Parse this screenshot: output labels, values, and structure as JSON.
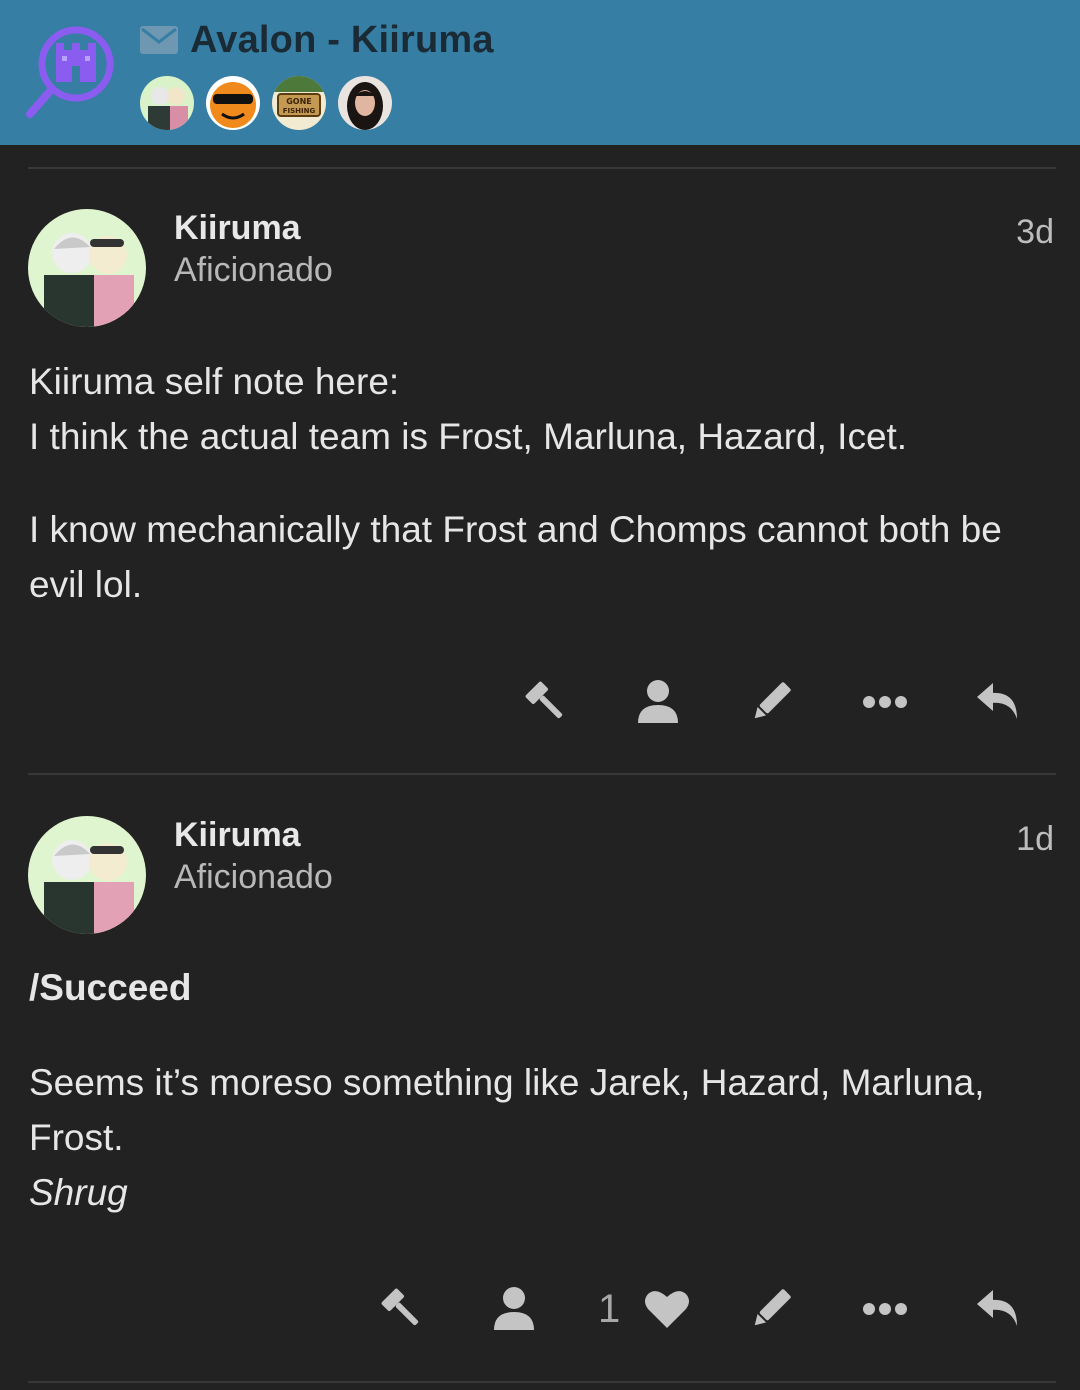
{
  "header": {
    "title": "Avalon - Kiiruma",
    "participants": [
      {
        "name": "kiiruma-avatar"
      },
      {
        "name": "sunglasses-orange-avatar"
      },
      {
        "name": "gone-fishing-avatar",
        "text": "GONE FISHING"
      },
      {
        "name": "woman-portrait-avatar"
      }
    ]
  },
  "posts": [
    {
      "username": "Kiiruma",
      "user_title": "Aficionado",
      "age": "3d",
      "lines": [
        "Kiiruma self note here:",
        "I think the actual team is Frost, Marluna, Hazard, Icet.",
        "I know mechanically that Frost and Chomps cannot both be evil lol."
      ],
      "actions": [
        "gavel-icon",
        "user-icon",
        "edit-icon",
        "more-icon",
        "reply-icon"
      ]
    },
    {
      "username": "Kiiruma",
      "user_title": "Aficionado",
      "age": "1d",
      "heading": "/Succeed",
      "lines": [
        "Seems it’s moreso something like Jarek, Hazard, Marluna, Frost.",
        "Shrug"
      ],
      "like_count": "1",
      "actions": [
        "gavel-icon",
        "user-icon",
        "heart-icon",
        "edit-icon",
        "more-icon",
        "reply-icon"
      ]
    }
  ],
  "colors": {
    "header_bg": "#367ea3",
    "page_bg": "#222222",
    "title_text": "#1b2b36",
    "logo_purple": "#8a5cf0"
  }
}
